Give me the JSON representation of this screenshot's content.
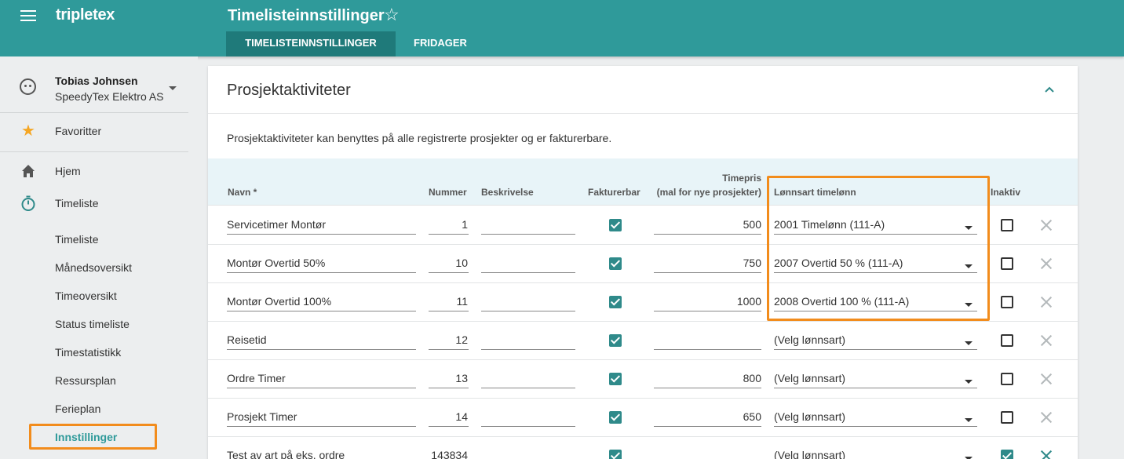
{
  "app": {
    "logo": "tripletex",
    "page_title": "Timelisteinnstillinger",
    "favorite_icon": "star-outline-icon"
  },
  "tabs": [
    {
      "label": "TIMELISTEINNSTILLINGER",
      "active": true
    },
    {
      "label": "FRIDAGER",
      "active": false
    }
  ],
  "user": {
    "name": "Tobias Johnsen",
    "company": "SpeedyTex Elektro AS"
  },
  "sidebar": {
    "favorites": "Favoritter",
    "home": "Hjem",
    "timesheet": "Timeliste",
    "sub_items": [
      "Timeliste",
      "Månedsoversikt",
      "Timeoversikt",
      "Status timeliste",
      "Timestatistikk",
      "Ressursplan",
      "Ferieplan",
      "Innstillinger"
    ],
    "active_sub": "Innstillinger"
  },
  "section": {
    "title": "Prosjektaktiviteter",
    "description": "Prosjektaktiviteter kan benyttes på alle registrerte prosjekter og er fakturerbare."
  },
  "table": {
    "headers": {
      "name": "Navn *",
      "number": "Nummer",
      "description": "Beskrivelse",
      "billable": "Fakturerbar",
      "price_1": "Timepris",
      "price_2": "(mal for nye prosjekter)",
      "wage_type": "Lønnsart timelønn",
      "inactive": "Inaktiv"
    },
    "rows": [
      {
        "name": "Servicetimer Montør",
        "number": "1",
        "description": "",
        "billable": true,
        "price": "500",
        "wage_type": "2001 Timelønn (111-A)",
        "inactive": false
      },
      {
        "name": " Montør Overtid 50%",
        "number": "10",
        "description": "",
        "billable": true,
        "price": "750",
        "wage_type": "2007 Overtid 50 % (111-A)",
        "inactive": false
      },
      {
        "name": " Montør Overtid 100%",
        "number": "11",
        "description": "",
        "billable": true,
        "price": "1000",
        "wage_type": "2008 Overtid 100 % (111-A)",
        "inactive": false
      },
      {
        "name": "Reisetid",
        "number": "12",
        "description": "",
        "billable": true,
        "price": "",
        "wage_type": "(Velg lønnsart)",
        "inactive": false
      },
      {
        "name": "Ordre Timer",
        "number": "13",
        "description": "",
        "billable": true,
        "price": "800",
        "wage_type": "(Velg lønnsart)",
        "inactive": false
      },
      {
        "name": "Prosjekt Timer",
        "number": "14",
        "description": "",
        "billable": true,
        "price": "650",
        "wage_type": "(Velg lønnsart)",
        "inactive": false
      },
      {
        "name": "Test av art på eks. ordre",
        "number": "143834",
        "description": "",
        "billable": true,
        "price": "",
        "wage_type": "(Velg lønnsart)",
        "inactive": true
      }
    ]
  },
  "colors": {
    "primary": "#2f9a9a",
    "tab_active": "#1f7a7a",
    "highlight": "#f28c1c",
    "checkbox": "#2f8a8a",
    "header_bg": "#e8f4f8"
  }
}
